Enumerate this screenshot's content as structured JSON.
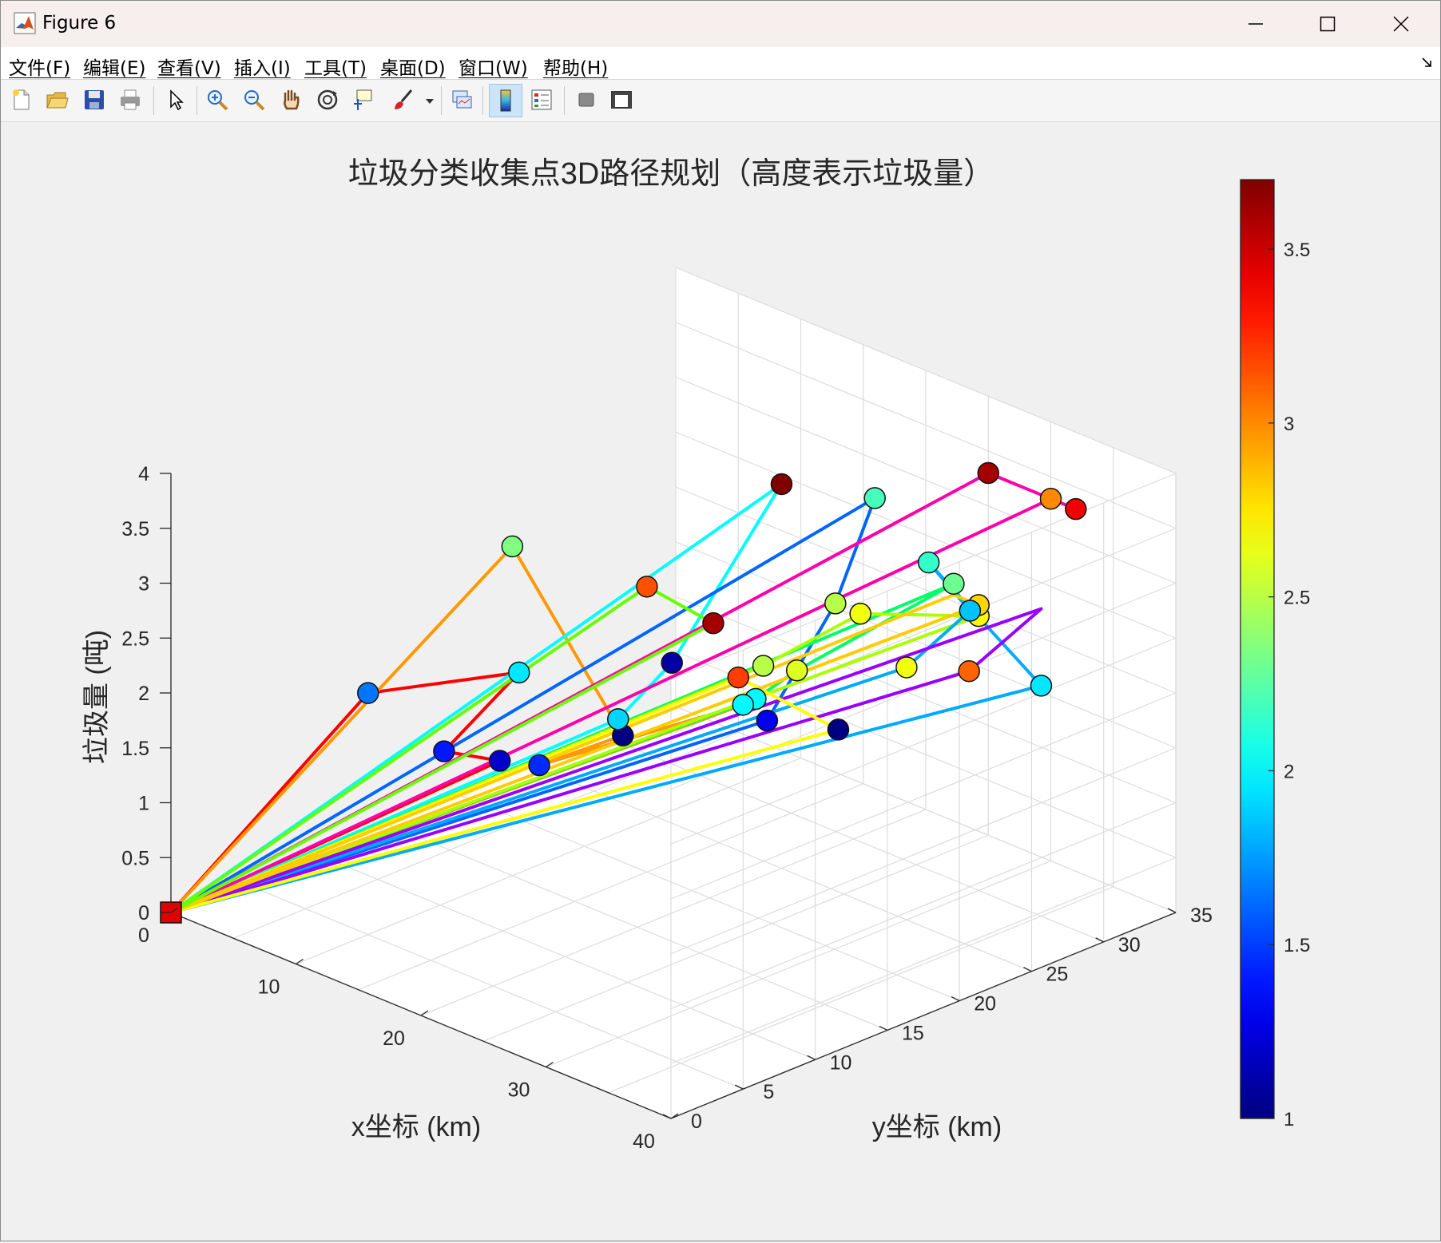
{
  "window": {
    "title": "Figure 6"
  },
  "menu": {
    "items": [
      "文件(F)",
      "编辑(E)",
      "查看(V)",
      "插入(I)",
      "工具(T)",
      "桌面(D)",
      "窗口(W)",
      "帮助(H)"
    ]
  },
  "toolbar": {
    "buttons": [
      "new-figure-icon",
      "open-file-icon",
      "save-icon",
      "print-icon",
      "pointer-icon",
      "zoom-in-icon",
      "zoom-out-icon",
      "pan-hand-icon",
      "rotate-3d-icon",
      "data-cursor-icon",
      "brush-icon",
      "link-plot-icon",
      "colorbar-icon",
      "legend-icon",
      "hide-plot-tools-icon",
      "show-plot-tools-icon"
    ]
  },
  "chart_data": {
    "type": "scatter3d-path",
    "title": "垃圾分类收集点3D路径规划（高度表示垃圾量）",
    "xlabel": "x坐标 (km)",
    "ylabel": "y坐标 (km)",
    "zlabel": "垃圾量 (吨)",
    "xlim": [
      0,
      40
    ],
    "ylim": [
      0,
      35
    ],
    "zlim": [
      0,
      4
    ],
    "x_ticks": [
      "0",
      "10",
      "20",
      "30",
      "40"
    ],
    "y_ticks": [
      "0",
      "5",
      "10",
      "15",
      "20",
      "25",
      "30",
      "35"
    ],
    "z_ticks": [
      "0",
      "0.5",
      "1",
      "1.5",
      "2",
      "2.5",
      "3",
      "3.5",
      "4"
    ],
    "colorbar": {
      "range": [
        1,
        3.7
      ],
      "ticks": [
        "1",
        "1.5",
        "2",
        "2.5",
        "3",
        "3.5"
      ],
      "colormap": "jet"
    },
    "grid": true,
    "depot": {
      "x": 0,
      "y": 0,
      "z": 0
    },
    "routes": [
      {
        "color": "#ff0000",
        "points": [
          [
            10,
            5,
            2.2
          ],
          [
            14,
            12,
            2.2
          ],
          [
            8,
            12,
            1.2
          ],
          [
            9,
            15,
            1.0
          ]
        ]
      },
      {
        "color": "#ff9900",
        "points": [
          [
            10,
            15,
            3.0
          ],
          [
            20,
            14,
            1.8
          ],
          [
            11,
            16,
            1.0
          ],
          [
            25,
            18,
            2.1
          ]
        ]
      },
      {
        "color": "#00ffff",
        "points": [
          [
            20,
            25,
            3.5
          ],
          [
            17,
            20,
            2.0
          ],
          [
            15,
            18,
            1.5
          ]
        ]
      },
      {
        "color": "#0066ff",
        "points": [
          [
            24,
            28,
            3.4
          ],
          [
            22,
            27,
            2.4
          ],
          [
            20,
            24,
            1.4
          ]
        ]
      },
      {
        "color": "#00ff66",
        "points": [
          [
            28,
            30,
            2.7
          ],
          [
            27,
            20,
            2.4
          ],
          [
            26,
            18,
            2.2
          ]
        ]
      },
      {
        "color": "#aaff00",
        "points": [
          [
            22,
            22,
            2.1
          ],
          [
            24,
            27,
            2.4
          ],
          [
            30,
            30,
            2.5
          ]
        ]
      },
      {
        "color": "#00aaff",
        "points": [
          [
            35,
            30,
            2.1
          ],
          [
            26,
            30,
            2.8
          ],
          [
            27,
            32,
            2.3
          ],
          [
            30,
            25,
            2.3
          ]
        ]
      },
      {
        "color": "#ff00aa",
        "points": [
          [
            25,
            35,
            3.3
          ],
          [
            32,
            35,
            3.3
          ],
          [
            30,
            35,
            3.3
          ]
        ]
      },
      {
        "color": "#9900ff",
        "points": [
          [
            35,
            30,
            2.8
          ],
          [
            35,
            25,
            2.5
          ]
        ]
      },
      {
        "color": "#ffff00",
        "points": [
          [
            28,
            22,
            1.8
          ],
          [
            20,
            22,
            1.9
          ]
        ]
      },
      {
        "color": "#ffcc00",
        "points": [
          [
            30,
            30,
            2.6
          ],
          [
            28,
            30,
            2.6
          ]
        ]
      },
      {
        "color": "#66ff00",
        "points": [
          [
            15,
            20,
            2.6
          ],
          [
            18,
            22,
            2.3
          ]
        ]
      }
    ],
    "points": [
      [
        10,
        5,
        2.2,
        1.65
      ],
      [
        14,
        12,
        2.2,
        1.95
      ],
      [
        8,
        12,
        1.2,
        1.4
      ],
      [
        9,
        15,
        1.0,
        1.2
      ],
      [
        10,
        15,
        3.0,
        2.35
      ],
      [
        20,
        14,
        1.8,
        1.0
      ],
      [
        11,
        16,
        1.0,
        1.45
      ],
      [
        25,
        18,
        2.1,
        2.0
      ],
      [
        20,
        25,
        3.5,
        3.7
      ],
      [
        17,
        20,
        2.0,
        1.1
      ],
      [
        15,
        18,
        1.5,
        1.9
      ],
      [
        24,
        28,
        3.4,
        2.2
      ],
      [
        22,
        27,
        2.4,
        2.5
      ],
      [
        20,
        24,
        1.4,
        1.3
      ],
      [
        28,
        30,
        2.7,
        2.3
      ],
      [
        27,
        20,
        2.4,
        2.6
      ],
      [
        26,
        18,
        2.2,
        2.0
      ],
      [
        22,
        22,
        2.1,
        2.5
      ],
      [
        24,
        27,
        2.4,
        2.65
      ],
      [
        30,
        30,
        2.5,
        2.7
      ],
      [
        35,
        30,
        2.1,
        1.95
      ],
      [
        26,
        30,
        2.8,
        2.15
      ],
      [
        27,
        32,
        2.3,
        1.85
      ],
      [
        30,
        25,
        2.3,
        2.65
      ],
      [
        25,
        35,
        3.3,
        3.6
      ],
      [
        32,
        35,
        3.3,
        3.4
      ],
      [
        30,
        35,
        3.3,
        3.0
      ],
      [
        35,
        25,
        2.5,
        3.1
      ],
      [
        28,
        22,
        1.8,
        1.0
      ],
      [
        20,
        22,
        1.9,
        3.2
      ],
      [
        15,
        20,
        2.6,
        3.15
      ],
      [
        18,
        22,
        2.3,
        3.6
      ],
      [
        30,
        30,
        2.6,
        2.8
      ]
    ]
  }
}
